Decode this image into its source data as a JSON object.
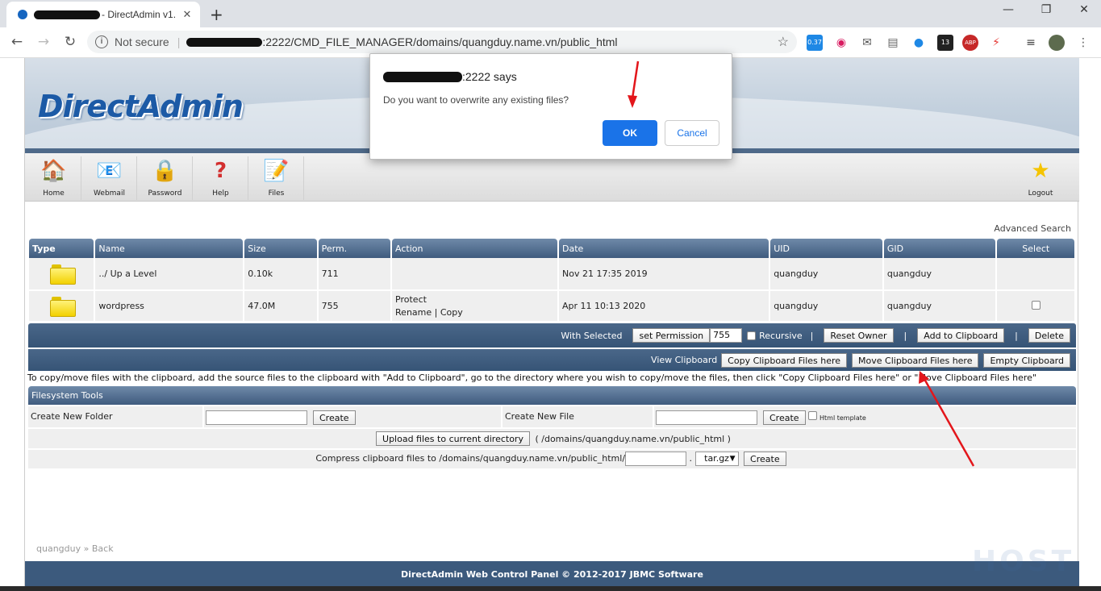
{
  "browser": {
    "tab_title": "- DirectAdmin v1.",
    "not_secure": "Not secure",
    "url": ":2222/CMD_FILE_MANAGER/domains/quangduy.name.vn/public_html",
    "ext_badge_1": "0.37",
    "ext_badge_2": "13",
    "ext_badge_3": "ABP"
  },
  "dialog": {
    "origin_suffix": ":2222 says",
    "message": "Do you want to overwrite any existing files?",
    "ok_label": "OK",
    "cancel_label": "Cancel"
  },
  "header": {
    "logo": "DirectAdmin"
  },
  "nav": {
    "home": "Home",
    "webmail": "Webmail",
    "password": "Password",
    "help": "Help",
    "files": "Files",
    "logout": "Logout"
  },
  "advanced_search": "Advanced Search",
  "table": {
    "columns": [
      "Type",
      "Name",
      "Size",
      "Perm.",
      "Action",
      "Date",
      "UID",
      "GID",
      "Select"
    ],
    "rows": [
      {
        "name": "../ Up a Level",
        "size": "0.10k",
        "perm": "711",
        "action_1": "",
        "action_2": "",
        "date": "Nov 21 17:35 2019",
        "uid": "quangduy",
        "gid": "quangduy"
      },
      {
        "name": "wordpress",
        "size": "47.0M",
        "perm": "755",
        "action_1": "Protect",
        "action_2": "Rename | Copy",
        "date": "Apr 11 10:13 2020",
        "uid": "quangduy",
        "gid": "quangduy"
      }
    ]
  },
  "actions": {
    "with_selected": "With Selected",
    "set_permission": "set Permission",
    "perm_value": "755",
    "recursive": "Recursive",
    "reset_owner": "Reset Owner",
    "add_clipboard": "Add to Clipboard",
    "delete": "Delete",
    "view_clipboard": "View Clipboard",
    "copy_clipboard": "Copy Clipboard Files here",
    "move_clipboard": "Move Clipboard Files here",
    "empty_clipboard": "Empty Clipboard",
    "pipe": "|"
  },
  "help_text": "To copy/move files with the clipboard, add the source files to the clipboard with \"Add to Clipboard\", go to the directory where you wish to copy/move the files, then click \"Copy Clipboard Files here\" or \"Move Clipboard Files here\"",
  "fs": {
    "title": "Filesystem Tools",
    "create_folder": "Create New Folder",
    "create_file": "Create New File",
    "create_btn": "Create",
    "html_template": "Html template",
    "upload_btn": "Upload files to current directory",
    "upload_path": "( /domains/quangduy.name.vn/public_html )",
    "compress_label": "Compress clipboard files to /domains/quangduy.name.vn/public_html/",
    "dot": ".",
    "compress_ext": "tar.gz"
  },
  "breadcrumb": {
    "user": "quangduy",
    "sep": "»",
    "back": "Back"
  },
  "footer": "DirectAdmin Web Control Panel © 2012-2017 JBMC Software",
  "watermark": "HOST",
  "colors": {
    "header_blue": "#3f5b7e",
    "dialog_ok": "#1a73e8",
    "arrow_red": "#e3161b"
  }
}
